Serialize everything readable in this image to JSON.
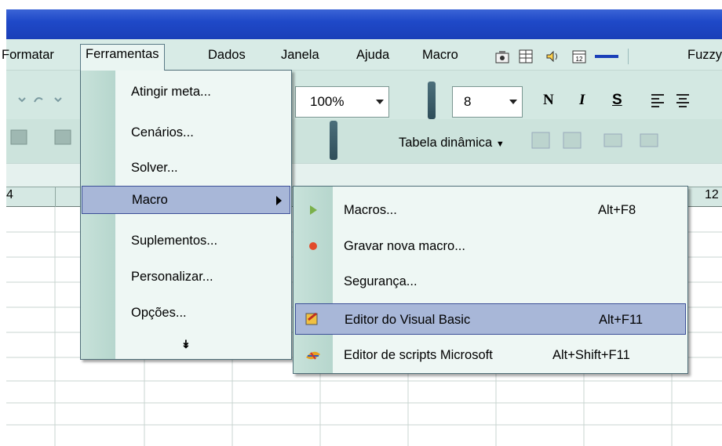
{
  "menubar": {
    "items": [
      {
        "label": "Formatar"
      },
      {
        "label": "Ferramentas"
      },
      {
        "label": "Dados"
      },
      {
        "label": "Janela"
      },
      {
        "label": "Ajuda"
      },
      {
        "label": "Macro"
      },
      {
        "label": "Fuzzy"
      }
    ]
  },
  "toolbar": {
    "zoom": "100%",
    "font_size": "8",
    "bold": "N",
    "italic": "I",
    "underline": "S",
    "pivot_table": "Tabela dinâmica",
    "icon_12": "12"
  },
  "column_headers": {
    "left_number": "4",
    "right_number": "12"
  },
  "ferramentas_menu": {
    "items": [
      {
        "label": "Atingir meta..."
      },
      {
        "label": "Cenários..."
      },
      {
        "label": "Solver..."
      },
      {
        "label": "Macro"
      },
      {
        "label": "Suplementos..."
      },
      {
        "label": "Personalizar..."
      },
      {
        "label": "Opções..."
      }
    ],
    "expand_icon": "double-chevron-down-icon"
  },
  "macro_submenu": {
    "items": [
      {
        "label": "Macros...",
        "shortcut": "Alt+F8",
        "icon": "play-icon"
      },
      {
        "label": "Gravar nova macro...",
        "shortcut": "",
        "icon": "record-icon"
      },
      {
        "label": "Segurança...",
        "shortcut": "",
        "icon": ""
      },
      {
        "label": "Editor do Visual Basic",
        "shortcut": "Alt+F11",
        "icon": "vb-editor-icon"
      },
      {
        "label": "Editor de scripts Microsoft",
        "shortcut": "Alt+Shift+F11",
        "icon": "script-editor-icon"
      }
    ]
  },
  "colors": {
    "titlebar": "#1f49c8",
    "menu_background": "#eef7f4",
    "highlight": "#a8b7d8",
    "highlight_border": "#3c4f98"
  }
}
